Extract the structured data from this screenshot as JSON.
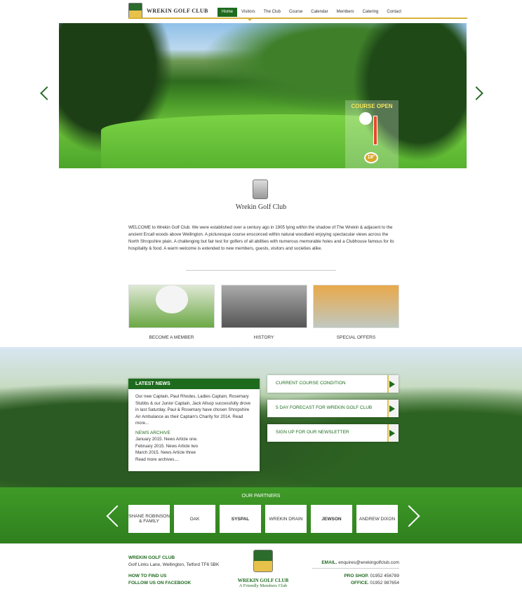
{
  "header": {
    "logo_text": "WREKIN GOLF CLUB",
    "nav": [
      "Home",
      "Visitors",
      "The Club",
      "Course",
      "Calendar",
      "Members",
      "Catering",
      "Contact"
    ],
    "active": "Home"
  },
  "hero": {
    "badge_title": "COURSE OPEN",
    "temperature": "19°"
  },
  "intro": {
    "title": "Wrekin Golf Club",
    "text": "WELCOME to Wrekin Golf Club. We were established over a century ago in 1905 lying within the shadow of The Wrekin & adjacent to the ancient Ercall woods above Wellington. A picturesque course ensconced within natural woodland enjoying spectacular views across the North Shropshire plain. A challenging but fair test for golfers of all abilities with numerous memorable holes and a Clubhouse famous for its hospitality & food. A warm welcome is extended to new members, guests, visitors and societies alike."
  },
  "cards": [
    {
      "label": "BECOME A MEMBER"
    },
    {
      "label": "HISTORY"
    },
    {
      "label": "SPECIAL OFFERS"
    }
  ],
  "news": {
    "header": "LATEST NEWS",
    "body": "Our new Captain, Paul Rhodes, Ladies Captain, Rosemary Stubbs & our Junior Captain, Jack Allsop successfully drove in last Saturday. Paul & Rosemary have chosen Shropshire Air Ambulance as their Captain's Charity for 2014. Read more...",
    "archive_title": "NEWS ARCHIVE",
    "archive": [
      "January 2015. News Article one.",
      "February 2015. News Article two",
      "March 2015. News Article three",
      "Read more archives...."
    ]
  },
  "panels": [
    "CURRENT COURSE CONDITION",
    "5 DAY FORECAST FOR WREKIN GOLF CLUB",
    "SIGN UP FOR OUR NEWSLETTER"
  ],
  "partners": {
    "title": "OUR PARTNERS",
    "logos": [
      "SHANE ROBINSON & FAMILY",
      "OAK",
      "SYSPAL",
      "WREKIN DRAIN",
      "JEWSON",
      "ANDREW DIXON"
    ]
  },
  "footer": {
    "club_name": "WREKIN GOLF CLUB",
    "address": "Golf Links Lane, Wellington, Telford TF6 5BK",
    "find_us": "HOW TO FIND US",
    "facebook": "FOLLOW US ON FACEBOOK",
    "center_name": "WREKIN GOLF CLUB",
    "center_tag": "A Friendly Members Club",
    "email_label": "EMAIL.",
    "email_value": "enquires@wrekingolfclub.com",
    "proshop_label": "PRO SHOP.",
    "proshop_value": "01952 456789",
    "office_label": "OFFICE.",
    "office_value": "01952 987654"
  },
  "colors": {
    "brand_green": "#1e6b1e",
    "accent_gold": "#d9b23a"
  }
}
